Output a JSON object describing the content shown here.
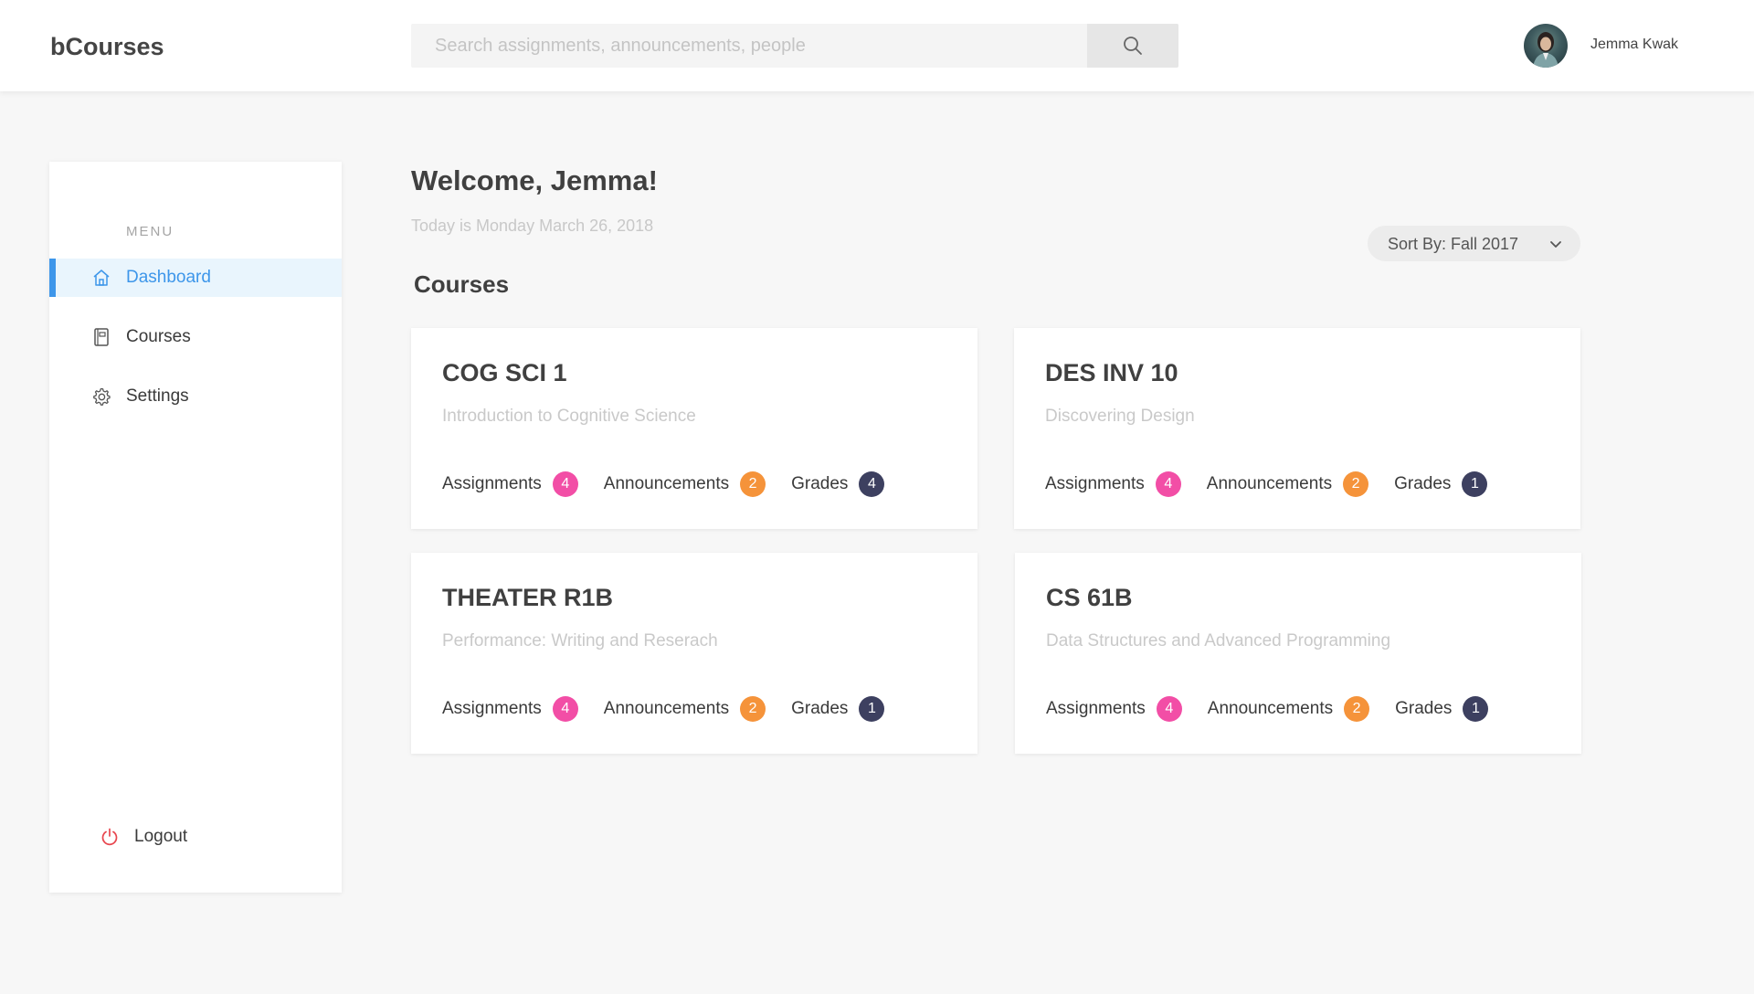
{
  "brand": "bCourses",
  "search": {
    "placeholder": "Search assignments, announcements, people",
    "value": ""
  },
  "user": {
    "name": "Jemma Kwak"
  },
  "sidebar": {
    "heading": "MENU",
    "items": [
      {
        "label": "Dashboard",
        "icon": "home-icon"
      },
      {
        "label": "Courses",
        "icon": "book-icon"
      },
      {
        "label": "Settings",
        "icon": "gear-icon"
      }
    ],
    "logout": {
      "label": "Logout",
      "icon": "power-icon"
    }
  },
  "main": {
    "welcome": "Welcome, Jemma!",
    "today": "Today is Monday March 26, 2018",
    "courses_heading": "Courses",
    "sort_label": "Sort By: Fall 2017"
  },
  "courses": [
    {
      "code": "COG SCI 1",
      "title": "Introduction to Cognitive Science",
      "assignments_label": "Assignments",
      "assignments": "4",
      "announcements_label": "Announcements",
      "announcements": "2",
      "grades_label": "Grades",
      "grades": "4"
    },
    {
      "code": "DES INV 10",
      "title": "Discovering Design",
      "assignments_label": "Assignments",
      "assignments": "4",
      "announcements_label": "Announcements",
      "announcements": "2",
      "grades_label": "Grades",
      "grades": "1"
    },
    {
      "code": "THEATER R1B",
      "title": "Performance: Writing and Reserach",
      "assignments_label": "Assignments",
      "assignments": "4",
      "announcements_label": "Announcements",
      "announcements": "2",
      "grades_label": "Grades",
      "grades": "1"
    },
    {
      "code": "CS 61B",
      "title": "Data Structures and Advanced Programming",
      "assignments_label": "Assignments",
      "assignments": "4",
      "announcements_label": "Announcements",
      "announcements": "2",
      "grades_label": "Grades",
      "grades": "1"
    }
  ],
  "colors": {
    "accent": "#3d96ea",
    "active_bg": "#e9f5fd",
    "assignments_badge": "#f24ea6",
    "announcements_badge": "#f5933a",
    "grades_badge": "#3d4060",
    "logout_icon": "#e8474f"
  }
}
